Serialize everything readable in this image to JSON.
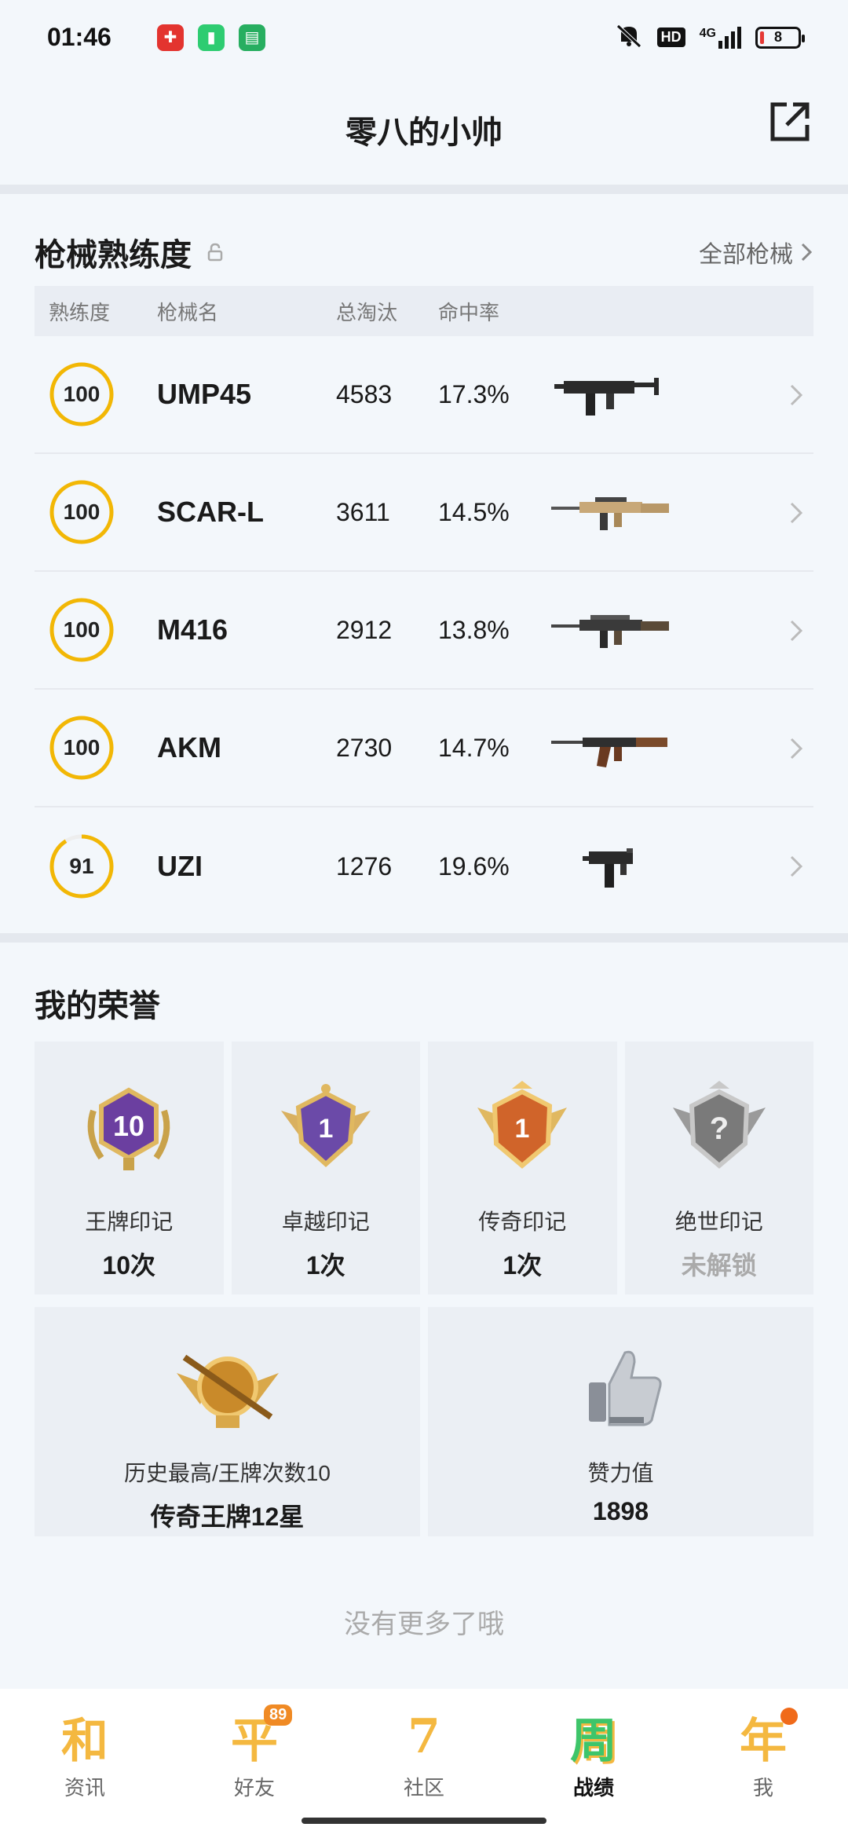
{
  "status_bar": {
    "time": "01:46",
    "network": "4G",
    "hd_label": "HD",
    "battery": "8"
  },
  "header": {
    "title": "零八的小帅"
  },
  "weapons": {
    "section_title": "枪械熟练度",
    "all_link": "全部枪械",
    "columns": {
      "proficiency": "熟练度",
      "name": "枪械名",
      "kills": "总淘汰",
      "hit_rate": "命中率"
    },
    "rows": [
      {
        "proficiency": "100",
        "level": 1.0,
        "name": "UMP45",
        "kills": "4583",
        "hit_rate": "17.3%",
        "icon": "smg-icon"
      },
      {
        "proficiency": "100",
        "level": 1.0,
        "name": "SCAR-L",
        "kills": "3611",
        "hit_rate": "14.5%",
        "icon": "rifle-icon"
      },
      {
        "proficiency": "100",
        "level": 1.0,
        "name": "M416",
        "kills": "2912",
        "hit_rate": "13.8%",
        "icon": "rifle-icon"
      },
      {
        "proficiency": "100",
        "level": 1.0,
        "name": "AKM",
        "kills": "2730",
        "hit_rate": "14.7%",
        "icon": "rifle-icon"
      },
      {
        "proficiency": "91",
        "level": 0.91,
        "name": "UZI",
        "kills": "1276",
        "hit_rate": "19.6%",
        "icon": "pistol-smg-icon"
      }
    ]
  },
  "honors": {
    "section_title": "我的荣誉",
    "marks": [
      {
        "label": "王牌印记",
        "value": "10次",
        "badge_text": "10",
        "locked": false
      },
      {
        "label": "卓越印记",
        "value": "1次",
        "badge_text": "1",
        "locked": false
      },
      {
        "label": "传奇印记",
        "value": "1次",
        "badge_text": "1",
        "locked": false
      },
      {
        "label": "绝世印记",
        "value": "未解锁",
        "badge_text": "?",
        "locked": true
      }
    ],
    "highest": {
      "label": "历史最高/王牌次数10",
      "value": "传奇王牌12星"
    },
    "likes": {
      "label": "赞力值",
      "value": "1898"
    }
  },
  "footer_text": "没有更多了哦",
  "bottom_nav": [
    {
      "glyph": "和",
      "label": "资讯",
      "active": false,
      "badge": ""
    },
    {
      "glyph": "平",
      "label": "好友",
      "active": false,
      "badge": "89"
    },
    {
      "glyph": "7",
      "label": "社区",
      "active": false,
      "badge": ""
    },
    {
      "glyph": "周",
      "label": "战绩",
      "active": true,
      "badge": ""
    },
    {
      "glyph": "年",
      "label": "我",
      "active": false,
      "badge": "dot"
    }
  ],
  "colors": {
    "accent": "#f4b840",
    "ring": "#f2b705",
    "background": "#f3f7fb"
  }
}
